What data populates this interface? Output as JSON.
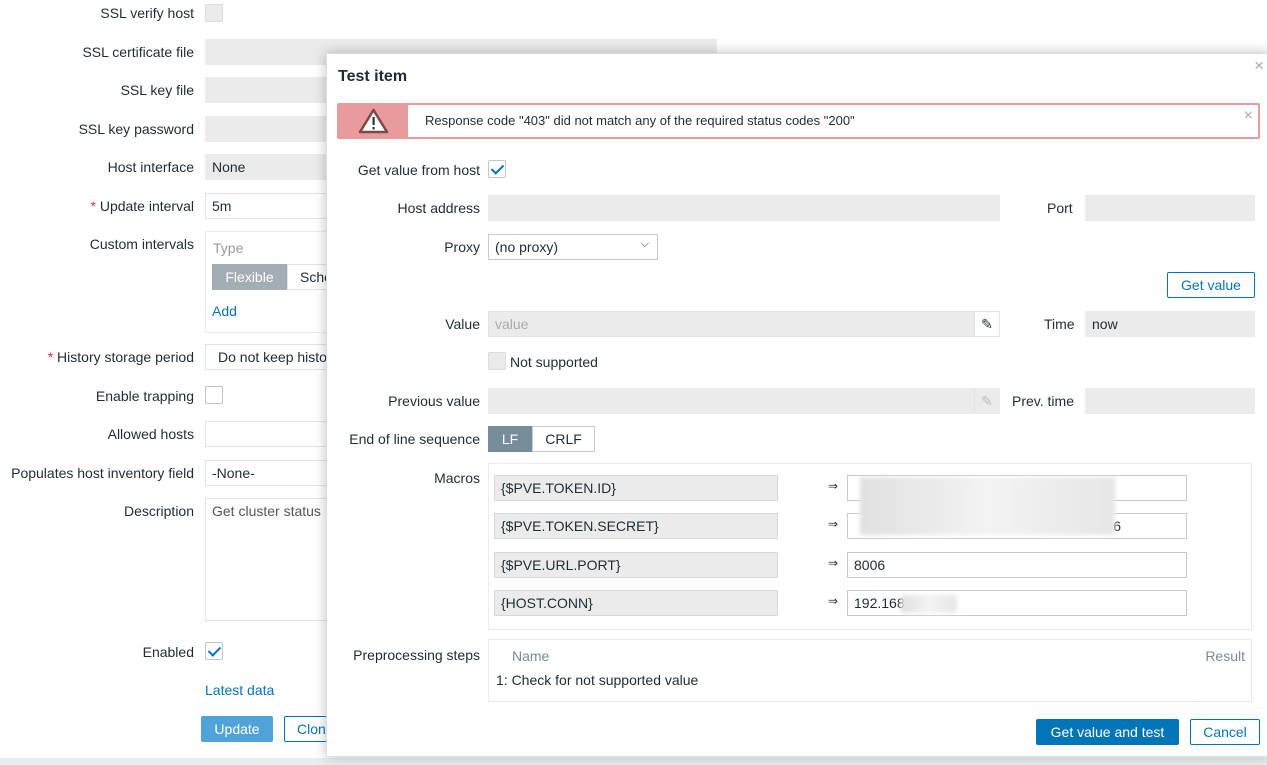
{
  "background_form": {
    "ssl_verify_host": "SSL verify host",
    "ssl_cert_file": "SSL certificate file",
    "ssl_key_file": "SSL key file",
    "ssl_key_password": "SSL key password",
    "host_interface": "Host interface",
    "host_interface_value": "None",
    "update_interval": "Update interval",
    "update_interval_value": "5m",
    "custom_intervals": "Custom intervals",
    "type_header": "Type",
    "flexible": "Flexible",
    "scheduling": "Sche",
    "add": "Add",
    "history_storage": "History storage period",
    "history_value": "Do not keep histo",
    "enable_trapping": "Enable trapping",
    "allowed_hosts": "Allowed hosts",
    "populates_inventory": "Populates host inventory field",
    "inventory_value": "-None-",
    "description": "Description",
    "description_value": "Get cluster status",
    "enabled": "Enabled",
    "latest_data": "Latest data",
    "update_btn": "Update",
    "clone_btn": "Clon"
  },
  "modal": {
    "title": "Test item",
    "close": "×",
    "error_message": "Response code \"403\" did not match any of the required status codes \"200\"",
    "error_close": "×",
    "get_value_from_host": "Get value from host",
    "host_address": "Host address",
    "port": "Port",
    "proxy": "Proxy",
    "proxy_value": "(no proxy)",
    "get_value_btn": "Get value",
    "value": "Value",
    "value_placeholder": "value",
    "time": "Time",
    "time_value": "now",
    "not_supported": "Not supported",
    "previous_value": "Previous value",
    "prev_time": "Prev. time",
    "eol_sequence": "End of line sequence",
    "eol_lf": "LF",
    "eol_crlf": "CRLF",
    "macros_label": "Macros",
    "macros": [
      {
        "name": "{$PVE.TOKEN.ID}",
        "value": ""
      },
      {
        "name": "{$PVE.TOKEN.SECRET}",
        "value": "6"
      },
      {
        "name": "{$PVE.URL.PORT}",
        "value": "8006"
      },
      {
        "name": "{HOST.CONN}",
        "value": "192.168"
      }
    ],
    "arrow": "⇒",
    "preprocessing_label": "Preprocessing steps",
    "pp_name_header": "Name",
    "pp_result_header": "Result",
    "pp_steps": [
      "1: Check for not supported value"
    ],
    "test_btn": "Get value and test",
    "cancel_btn": "Cancel"
  }
}
